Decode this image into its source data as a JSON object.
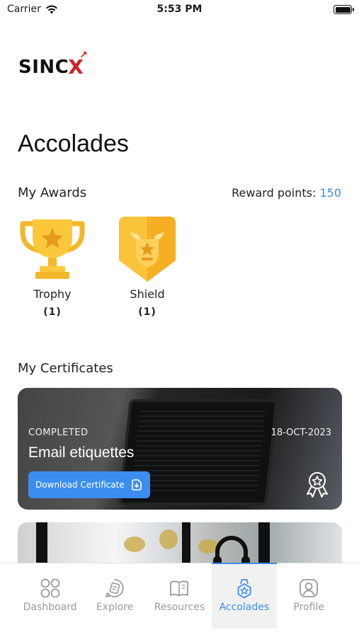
{
  "status_bar": {
    "carrier": "Carrier",
    "time": "5:53 PM"
  },
  "logo": {
    "text": "SINC",
    "mark": "X"
  },
  "page": {
    "title": "Accolades"
  },
  "awards": {
    "title": "My Awards",
    "reward_points_label": "Reward points:",
    "reward_points_value": "150",
    "items": [
      {
        "name": "Trophy",
        "count": "(1)",
        "icon": "trophy-icon"
      },
      {
        "name": "Shield",
        "count": "(1)",
        "icon": "shield-icon"
      }
    ]
  },
  "certificates": {
    "title": "My Certificates",
    "items": [
      {
        "status": "COMPLETED",
        "date": "18-OCT-2023",
        "title": "Email etiquettes",
        "download_label": "Download Certificate",
        "badge_icon": "award-ribbon-icon"
      }
    ]
  },
  "tab_bar": {
    "items": [
      {
        "label": "Dashboard",
        "icon": "grid-icon",
        "active": false
      },
      {
        "label": "Explore",
        "icon": "explore-chat-icon",
        "active": false
      },
      {
        "label": "Resources",
        "icon": "book-icon",
        "active": false
      },
      {
        "label": "Accolades",
        "icon": "medal-icon",
        "active": true
      },
      {
        "label": "Profile",
        "icon": "profile-icon",
        "active": false
      }
    ]
  },
  "colors": {
    "accent": "#3b8ef0",
    "logo_mark": "#d32222",
    "award_gold": "#f9c33a"
  }
}
